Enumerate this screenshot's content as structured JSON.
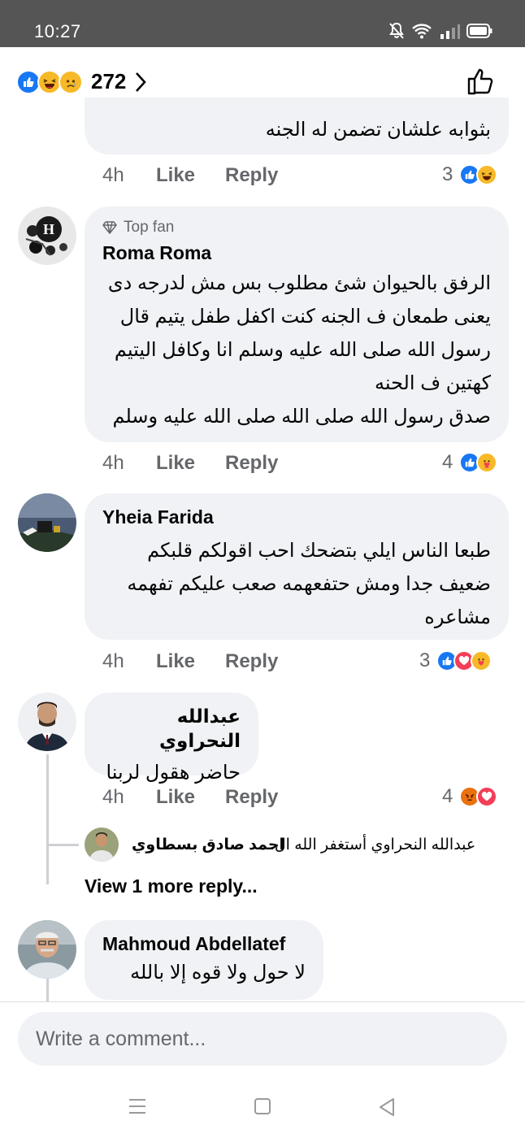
{
  "status_bar": {
    "time": "10:27"
  },
  "header": {
    "reaction_count": "272",
    "reaction_icons": [
      "like",
      "haha",
      "sad"
    ]
  },
  "comments": [
    {
      "text": "بثوابه علشان تضمن له الجنه",
      "time": "4h",
      "like_label": "Like",
      "reply_label": "Reply",
      "reaction_count": "3",
      "reaction_icons": [
        "like",
        "haha"
      ]
    },
    {
      "badge": "Top fan",
      "author": "Roma Roma",
      "text": "الرفق بالحيوان شئ مطلوب بس مش لدرجه دى\nيعنى طمعان ف الجنه كنت اكفل طفل يتيم قال\nرسول الله صلى الله عليه وسلم انا وكافل اليتيم\nكهتين ف الحنه\nصدق رسول الله صلى الله صلى الله عليه وسلم",
      "time": "4h",
      "like_label": "Like",
      "reply_label": "Reply",
      "reaction_count": "4",
      "reaction_icons": [
        "like",
        "care"
      ]
    },
    {
      "author": "Yheia Farida",
      "text": "طبعا الناس ايلي بتضحك احب اقولكم قلبكم\nضعيف جدا ومش حتفعهمه صعب عليكم تفهمه\nمشاعره",
      "time": "4h",
      "like_label": "Like",
      "reply_label": "Reply",
      "reaction_count": "3",
      "reaction_icons": [
        "like",
        "love",
        "care"
      ]
    },
    {
      "author": "عبدالله النحراوي",
      "text": "حاضر هقول لربنا",
      "time": "4h",
      "like_label": "Like",
      "reply_label": "Reply",
      "reaction_count": "4",
      "reaction_icons": [
        "angry",
        "love"
      ],
      "reply_preview": {
        "author": "احمد صادق بسطاوي",
        "text": "عبدالله النحراوي أستغفر الله ال..."
      },
      "more_replies": "View 1 more reply..."
    },
    {
      "author": "Mahmoud Abdellatef",
      "text": "لا حول ولا قوه إلا بالله"
    }
  ],
  "composer": {
    "placeholder": "Write a comment..."
  },
  "colors": {
    "like": "#1877f2",
    "love": "#f33e58",
    "yellow": "#f7b928",
    "angry": "#e9710f",
    "bubble": "#f0f2f5",
    "meta": "#65676b"
  }
}
